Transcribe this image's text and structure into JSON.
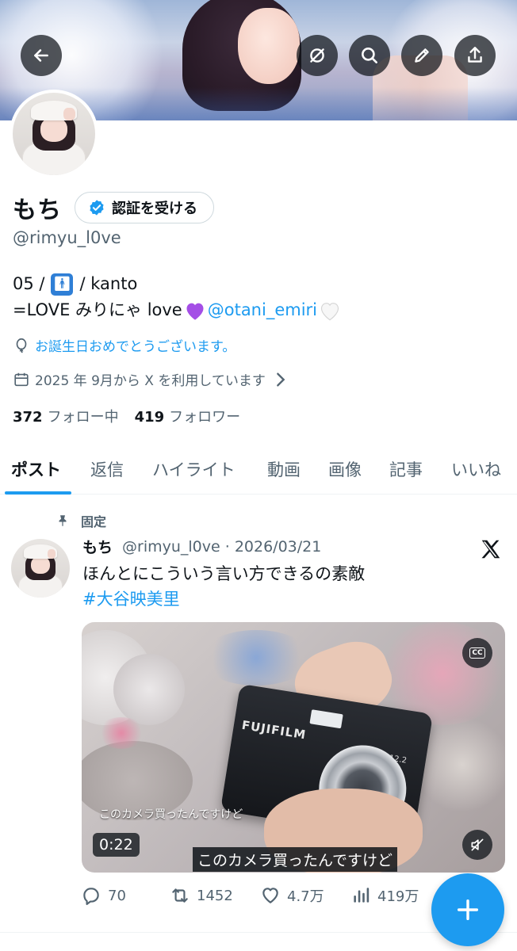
{
  "profile": {
    "display_name": "もち",
    "verify_label": "認証を受ける",
    "handle": "@rimyu_l0ve",
    "bio_line1_prefix": "05 /",
    "bio_line1_suffix": "/ kanto",
    "bio_line2_prefix": "=LOVE みりにゃ love",
    "bio_mention": "@otani_emiri",
    "birthday_text": "お誕生日おめでとうございます。",
    "joined_text": "2025 年 9月から X を利用しています",
    "following_count": "372",
    "following_label": "フォロー中",
    "followers_count": "419",
    "followers_label": "フォロワー"
  },
  "header_buttons": [
    "back-arrow-icon",
    "grok-icon",
    "search-icon",
    "edit-icon",
    "share-icon"
  ],
  "tabs": [
    {
      "label": "ポスト",
      "active": true
    },
    {
      "label": "返信"
    },
    {
      "label": "ハイライト"
    },
    {
      "label": "動画"
    },
    {
      "label": "画像"
    },
    {
      "label": "記事"
    },
    {
      "label": "いいね"
    }
  ],
  "post": {
    "pinned_label": "固定",
    "author_name": "もち",
    "author_handle_date": "@rimyu_l0ve · 2026/03/21",
    "text": "ほんとにこういう言い方できるの素敵",
    "hashtag": "#大谷映美里",
    "video": {
      "camera_brand": "FUJIFILM",
      "camera_badge": "12.2",
      "caption_small": "このカメラ買ったんですけど",
      "duration": "0:22",
      "caption_bottom": "このカメラ買ったんですけど",
      "cc_label": "CC"
    },
    "stats": {
      "replies": "70",
      "reposts": "1452",
      "likes": "4.7万",
      "views": "419万"
    }
  },
  "colors": {
    "accent": "#1d9bf0",
    "text_primary": "#0f1419",
    "text_secondary": "#536471",
    "purple_heart": "#a44ee6"
  }
}
